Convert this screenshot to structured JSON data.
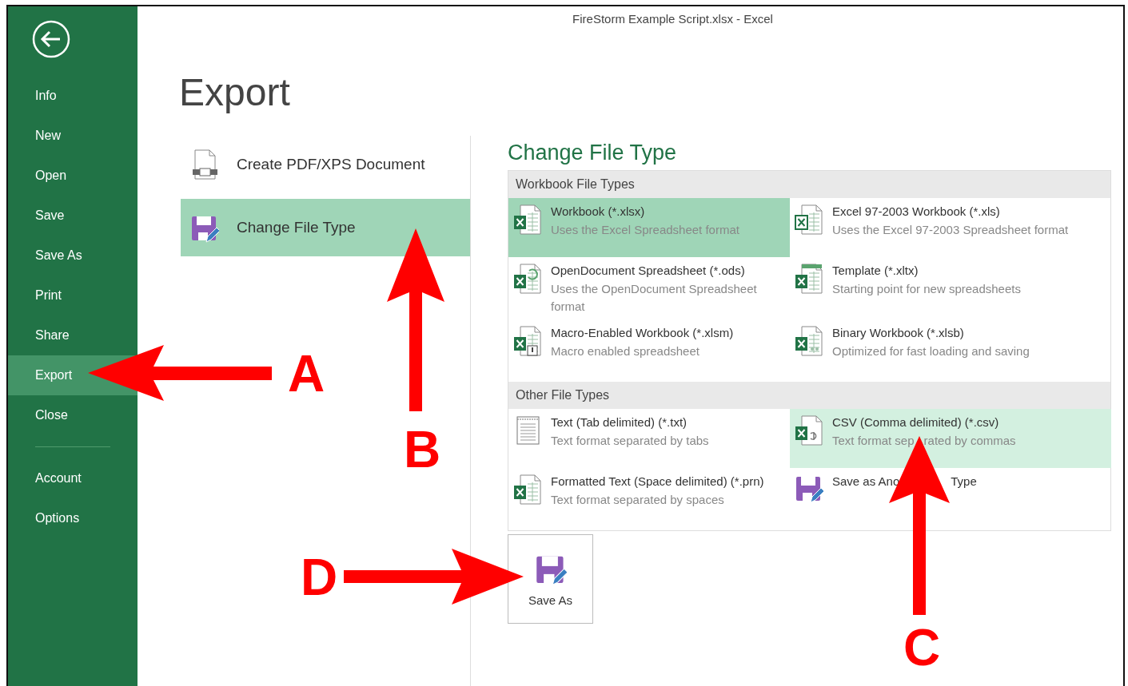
{
  "window": {
    "title": "FireStorm Example Script.xlsx - Excel"
  },
  "sidebar": {
    "items": [
      {
        "label": "Info",
        "selected": false
      },
      {
        "label": "New",
        "selected": false
      },
      {
        "label": "Open",
        "selected": false
      },
      {
        "label": "Save",
        "selected": false
      },
      {
        "label": "Save As",
        "selected": false
      },
      {
        "label": "Print",
        "selected": false
      },
      {
        "label": "Share",
        "selected": false
      },
      {
        "label": "Export",
        "selected": true
      },
      {
        "label": "Close",
        "selected": false
      }
    ],
    "lower_items": [
      {
        "label": "Account",
        "selected": false
      },
      {
        "label": "Options",
        "selected": false
      }
    ]
  },
  "page_title": "Export",
  "export_options": [
    {
      "kind": "pdf",
      "label": "Create PDF/XPS Document",
      "selected": false
    },
    {
      "kind": "change",
      "label": "Change File Type",
      "selected": true
    }
  ],
  "change_file_type": {
    "title": "Change File Type",
    "sections": [
      {
        "title": "Workbook File Types",
        "items": [
          {
            "kind": "xlsx",
            "name": "Workbook (*.xlsx)",
            "description": "Uses the Excel Spreadsheet format",
            "selected": true,
            "hovered": false
          },
          {
            "kind": "xls",
            "name": "Excel 97-2003 Workbook (*.xls)",
            "description": "Uses the Excel 97-2003 Spreadsheet format",
            "selected": false,
            "hovered": false
          },
          {
            "kind": "ods",
            "name": "OpenDocument Spreadsheet (*.ods)",
            "description": "Uses the OpenDocument Spreadsheet format",
            "selected": false,
            "hovered": false
          },
          {
            "kind": "xltx",
            "name": "Template (*.xltx)",
            "description": "Starting point for new spreadsheets",
            "selected": false,
            "hovered": false
          },
          {
            "kind": "xlsm",
            "name": "Macro-Enabled Workbook (*.xlsm)",
            "description": "Macro enabled spreadsheet",
            "selected": false,
            "hovered": false
          },
          {
            "kind": "xlsb",
            "name": "Binary Workbook (*.xlsb)",
            "description": "Optimized for fast loading and saving",
            "selected": false,
            "hovered": false
          }
        ]
      },
      {
        "title": "Other File Types",
        "items": [
          {
            "kind": "txt",
            "name": "Text (Tab delimited) (*.txt)",
            "description": "Text format separated by tabs",
            "selected": false,
            "hovered": false
          },
          {
            "kind": "csv",
            "name": "CSV (Comma delimited) (*.csv)",
            "description": [
              "Text format sep",
              "rated by commas"
            ],
            "selected": false,
            "hovered": true
          },
          {
            "kind": "prn",
            "name": "Formatted Text (Space delimited) (*.prn)",
            "description": "Text format separated by spaces",
            "selected": false,
            "hovered": false
          },
          {
            "kind": "other",
            "name": [
              "Save as Ano",
              "Type"
            ],
            "selected": false,
            "hovered": false
          }
        ]
      }
    ]
  },
  "save_as_button": {
    "label": "Save As"
  },
  "annotations": [
    {
      "label": "A"
    },
    {
      "label": "B"
    },
    {
      "label": "C"
    },
    {
      "label": "D"
    }
  ]
}
